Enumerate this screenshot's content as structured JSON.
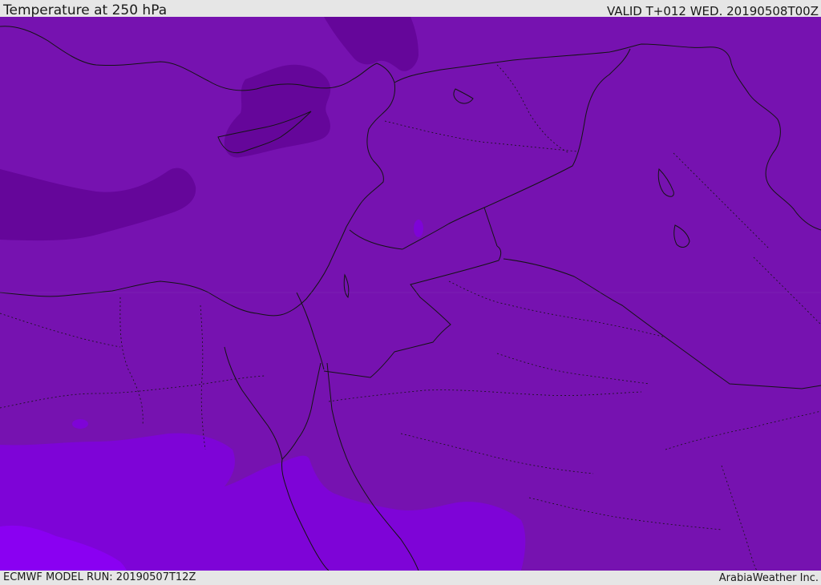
{
  "header": {
    "title": "Temperature at 250 hPa",
    "valid_time": "VALID T+012 WED. 20190508T00Z"
  },
  "footer": {
    "model_run": "ECMWF MODEL RUN: 20190507T12Z",
    "credit": "ArabiaWeather Inc."
  },
  "colors": {
    "base_field": "#7612b0",
    "cold_core": "#65069a",
    "warm_zone": "#7e04d7",
    "warmest_zone": "#8a00f2",
    "boundaries": "#141414"
  }
}
